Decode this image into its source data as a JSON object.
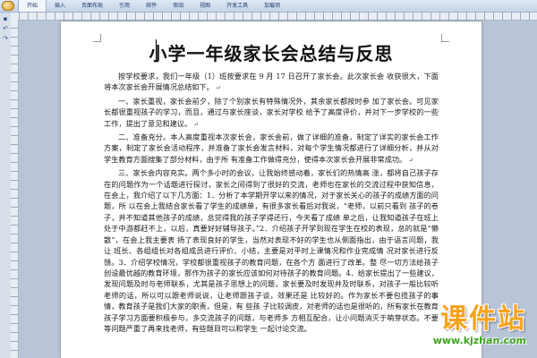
{
  "ribbon": {
    "tabs": [
      "开始",
      "插入",
      "页面布局",
      "引用",
      "邮件",
      "审阅",
      "视图",
      "开发工具",
      "加载项"
    ]
  },
  "quick_access": {
    "icons": [
      "save-icon",
      "undo-icon",
      "redo-icon"
    ]
  },
  "document": {
    "title": "小学一年级家长会总结与反思",
    "paragraphs": [
      "按学校要求，我们一年级（1）班按要求在 9 月 17 日召开了家长会。此次家长会 收获很大，下面将本次家长会开展情况总结如下。",
      "一、家长重视，家长会前夕，除了个别家长有特殊情况外，其余家长都按时参 加了家长会。可见家长都很重视孩子的学习，而且，通过与家长座谈，家长对学校 给予了高度评价，并对下一步学校的一些工作，提出了意见和建议。",
      "二、准备充分。本人高度重视本次家长会，家长会前，做了详细的准备，制定了详实的家长会工作方案，制定了家长会活动程序，并准备了家长会发言材料，对每个学生情况都进行了详细分析，并从对学生教育方面搜集了部分材料，由于所 有准备工作做得充分，使得本次家长会开展非常成功。",
      "三、家长会内容充实。两个多小时的会议，让我始终感动着，家长们的热情高 涨，都将自己孩子存在的问题作为一个话题进行探讨，家长之间得到了很好的交流，老师也在家长的交流过程中获知信息，在会上，我介绍了以下几方面：1．分析了本学期开学以来的情况，对于家长关心的孩子的成绩方面的问题，所 以在会上我结合家长看了学生的成绩单，有很多家长看后对我说，“老师，以前只看到 孩子的卷子，并不知道其他孩子的成绩，总觉得我的孩子学得还行，今天看了成绩 单之后，让我知道孩子在班上处于中游都赶不上，以后，真要好好辅导孩子。”2．介绍孩子开学到现在学生在校的表现，总的就是“懒散”，在会上我主要表 扬了表现良好的学生，当然对表现不好的学生也从侧面指出，由于语言问题，我让 班长、各组组长对各组成员进行评价、小结，主要是对平时上课情况和作业完成情 况对家长进行反馈。3．介绍学校情况，学校都很重视孩子的教育问题，在各个方 面进行了改革。整 尽一切方法给孩子创设最优越的教育环境，那作为孩子的家长应该如何对待孩子的教育问题。4．给家长提出了一些建议，发现问题及时与老师联系，尤其是孩子思想上的问题，家长要及时发现并及时联系，对孩子一般比较听老师的话，所以可以跟老师说说，让老师跟孩子谈，效果还是 比较好的。作为家长不要包揽孩子的事情，教育孩子是我们大家的职责，但是，有 些孩 子比较调皮，对老师的话也是很听的，所有家长在教育孩子学习方面要积极参与，多交流孩子的问题，与老师多 方相互配合，让小问题消灭于萌芽状态。不要等问题严重了再来找老师，有些题目可以和学生 一起讨论交流。"
    ]
  },
  "watermark": {
    "main": "课件站",
    "url": "www.kjzhan.com"
  },
  "colors": {
    "ribbon": "#c6d5ea",
    "workspace": "#b9c5d6",
    "watermark_orange": "#f7a21b",
    "watermark_green": "#3da21f"
  }
}
